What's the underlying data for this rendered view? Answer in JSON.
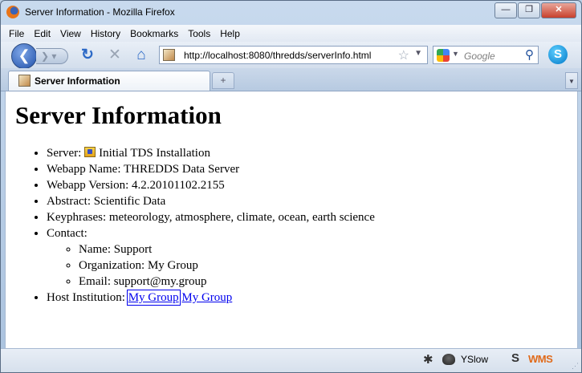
{
  "window": {
    "title": "Server Information - Mozilla Firefox",
    "minimize": "—",
    "maximize": "❐",
    "close": "✕"
  },
  "menu": [
    "File",
    "Edit",
    "View",
    "History",
    "Bookmarks",
    "Tools",
    "Help"
  ],
  "nav": {
    "url": "http://localhost:8080/thredds/serverInfo.html",
    "search_placeholder": "Google"
  },
  "tab": {
    "label": "Server Information"
  },
  "page": {
    "heading": "Server Information",
    "server_label": "Server:",
    "server_value": "Initial TDS Installation",
    "webapp_name": "Webapp Name: THREDDS Data Server",
    "webapp_version": "Webapp Version: 4.2.20101102.2155",
    "abstract": "Abstract: Scientific Data",
    "keyphrases": "Keyphrases: meteorology, atmosphere, climate, ocean, earth science",
    "contact_label": "Contact:",
    "contact": {
      "name": "Name: Support",
      "organization": "Organization: My Group",
      "email": "Email: support@my.group"
    },
    "host_label": "Host Institution:",
    "host_link_1": "My Group",
    "host_link_2": "My Group"
  },
  "status": {
    "yslow": "YSlow",
    "wms": "WMS"
  },
  "colors": {
    "link": "#0000ee",
    "chrome": "#bcd0e6"
  },
  "icons": [
    "firefox-icon",
    "back-arrow-icon",
    "forward-arrow-icon",
    "reload-icon",
    "stop-icon",
    "home-icon",
    "star-icon",
    "google-icon",
    "magnifier-icon",
    "skype-icon",
    "server-icon",
    "bug-icon",
    "yslow-icon",
    "s-icon"
  ]
}
